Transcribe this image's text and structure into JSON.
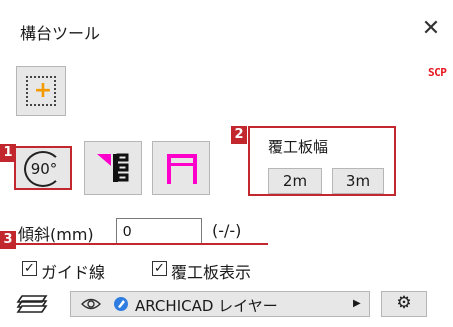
{
  "window": {
    "title": "構台ツール",
    "close_glyph": "✕",
    "badge": "SCP"
  },
  "toolbar": {
    "add_icon": "plus-square-dotted-icon",
    "add_glyph": "+",
    "rotate_label": "90°",
    "leg_icon": "leg-select-icon",
    "frame_icon": "frame-icon"
  },
  "markers": [
    "1",
    "2",
    "3"
  ],
  "board_width": {
    "label": "覆工板幅",
    "options": [
      "2m",
      "3m"
    ]
  },
  "slope": {
    "label": "傾斜(mm)",
    "value": "0",
    "unit": "(-/-)"
  },
  "checkboxes": [
    {
      "label": "ガイド線",
      "checked": true
    },
    {
      "label": "覆工板表示",
      "checked": true
    }
  ],
  "layer": {
    "icon": "layers-icon",
    "visibility_icon": "eye-icon",
    "pen_icon": "pen-icon",
    "name": "ARCHICAD レイヤー",
    "dropdown_glyph": "▶"
  },
  "settings": {
    "icon": "gear-icon",
    "glyph": "⚙"
  },
  "colors": {
    "highlight": "#c1272d",
    "accent_magenta": "#ff00cc",
    "accent_orange": "#f29a00",
    "badge_red": "#e8141e",
    "button_face": "#e7e7e7"
  }
}
